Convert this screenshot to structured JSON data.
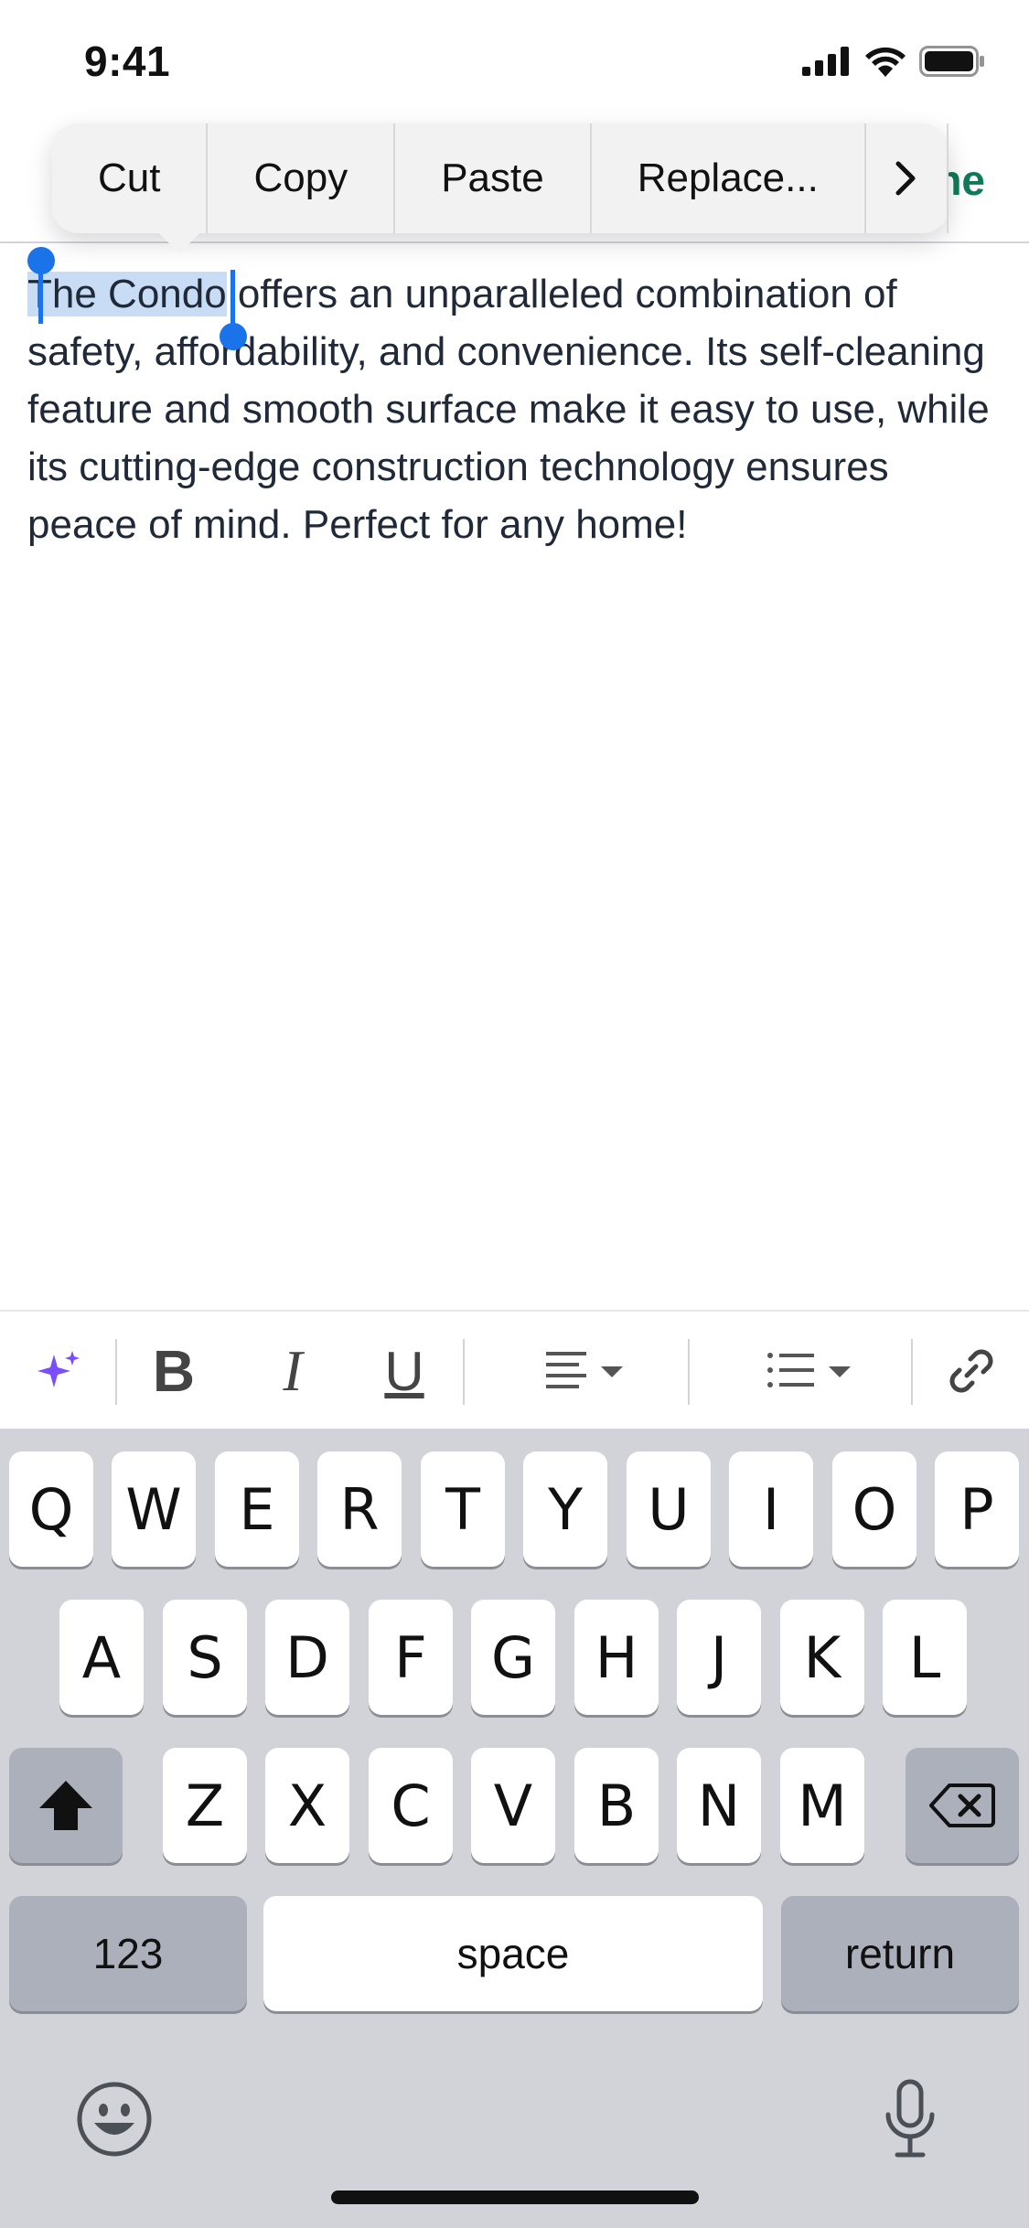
{
  "status_bar": {
    "time": "9:41"
  },
  "nav": {
    "right_action_partial": "ne"
  },
  "edit_menu": {
    "items": [
      "Cut",
      "Copy",
      "Paste",
      "Replace..."
    ],
    "more_icon": "chevron-right-icon"
  },
  "document": {
    "selected_text": "The Condo",
    "rest_text": " offers an unparalleled combination of safety, affordability, and convenience. Its self-cleaning feature and smooth surface make it easy to use, while its cutting-edge construction technology ensures peace of mind. Perfect for any home!"
  },
  "format_toolbar": {
    "ai_icon": "sparkles-icon",
    "bold_label": "B",
    "italic_label": "I",
    "underline_label": "U",
    "align_icon": "align-left-icon",
    "list_icon": "bulleted-list-icon",
    "link_icon": "link-icon"
  },
  "keyboard": {
    "row1": [
      "Q",
      "W",
      "E",
      "R",
      "T",
      "Y",
      "U",
      "I",
      "O",
      "P"
    ],
    "row2": [
      "A",
      "S",
      "D",
      "F",
      "G",
      "H",
      "J",
      "K",
      "L"
    ],
    "row3": [
      "Z",
      "X",
      "C",
      "V",
      "B",
      "N",
      "M"
    ],
    "numbers_label": "123",
    "space_label": "space",
    "return_label": "return"
  },
  "colors": {
    "selection": "#c8dcf5",
    "handle": "#1a73e8",
    "accent_green": "#0f7a5a",
    "ai_purple": "#7c4dff",
    "keyboard_bg": "#d1d3d9"
  }
}
